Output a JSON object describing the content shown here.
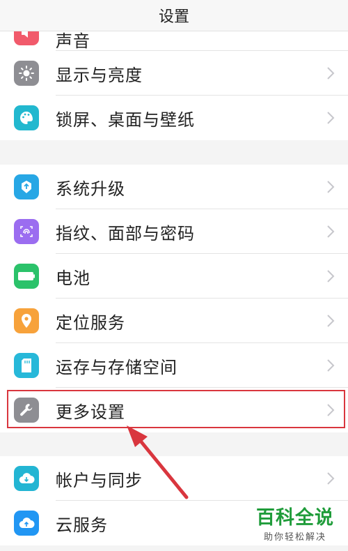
{
  "header": {
    "title": "设置"
  },
  "group1": {
    "items": [
      {
        "label": "声音",
        "icon": "sound-icon",
        "color": "#f15a6b"
      },
      {
        "label": "显示与亮度",
        "icon": "brightness-icon",
        "color": "#8e8e93"
      },
      {
        "label": "锁屏、桌面与壁纸",
        "icon": "palette-icon",
        "color": "#22b8cf"
      }
    ]
  },
  "group2": {
    "items": [
      {
        "label": "系统升级",
        "icon": "system-update-icon",
        "color": "#27a7e5"
      },
      {
        "label": "指纹、面部与密码",
        "icon": "fingerprint-icon",
        "color": "#9b6df0"
      },
      {
        "label": "电池",
        "icon": "battery-icon",
        "color": "#2bc26a"
      },
      {
        "label": "定位服务",
        "icon": "location-icon",
        "color": "#f7a23b"
      },
      {
        "label": "运存与存储空间",
        "icon": "storage-icon",
        "color": "#27b8d9"
      },
      {
        "label": "更多设置",
        "icon": "wrench-icon",
        "color": "#8e8e93"
      }
    ]
  },
  "group3": {
    "items": [
      {
        "label": "帐户与同步",
        "icon": "account-sync-icon",
        "color": "#23b5d3"
      },
      {
        "label": "云服务",
        "icon": "cloud-icon",
        "color": "#2196f3"
      }
    ]
  },
  "watermark": {
    "title": "百科全说",
    "subtitle": "助你轻松解决"
  }
}
